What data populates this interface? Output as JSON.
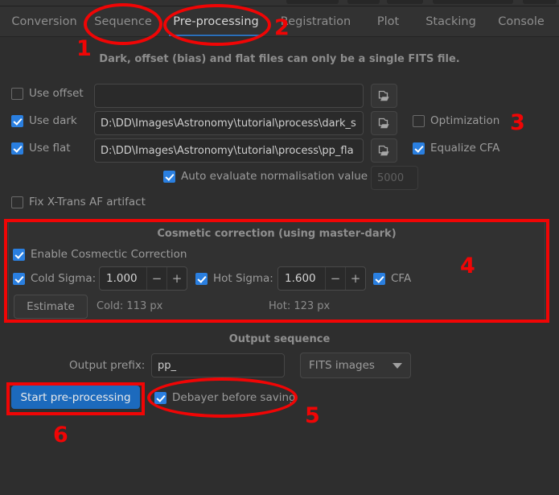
{
  "window": {
    "toolbar_buttons": [
      "",
      "",
      "",
      "",
      ""
    ]
  },
  "tabs": [
    {
      "label": "Conversion",
      "active": false
    },
    {
      "label": "Sequence",
      "active": false
    },
    {
      "label": "Pre-processing",
      "active": true
    },
    {
      "label": "Registration",
      "active": false
    },
    {
      "label": "Plot",
      "active": false
    },
    {
      "label": "Stacking",
      "active": false
    },
    {
      "label": "Console",
      "active": false
    }
  ],
  "preprocessing": {
    "note": "Dark, offset (bias) and flat files can only be a single FITS file.",
    "offset": {
      "checkbox_label": "Use offset",
      "checked": false,
      "path": "",
      "browse_icon": "open-file-icon"
    },
    "dark": {
      "checkbox_label": "Use dark",
      "checked": true,
      "path": "D:\\DD\\Images\\Astronomy\\tutorial\\process\\dark_s",
      "browse_icon": "open-file-icon",
      "optimization_label": "Optimization",
      "optimization_checked": false
    },
    "flat": {
      "checkbox_label": "Use flat",
      "checked": true,
      "path": "D:\\DD\\Images\\Astronomy\\tutorial\\process\\pp_fla",
      "browse_icon": "open-file-icon",
      "equalize_cfa_label": "Equalize CFA",
      "equalize_cfa_checked": true
    },
    "auto_normalisation": {
      "label": "Auto evaluate normalisation value",
      "checked": true,
      "value": "5000"
    },
    "xtrans": {
      "label": "Fix X-Trans AF artifact",
      "checked": false
    },
    "cosmetic": {
      "title": "Cosmetic correction (using master-dark)",
      "enable_label": "Enable Cosmectic Correction",
      "enable_checked": true,
      "cold_sigma": {
        "label": "Cold Sigma:",
        "checked": true,
        "value": "1.000",
        "minus": "−",
        "plus": "+"
      },
      "hot_sigma": {
        "label": "Hot Sigma:",
        "checked": true,
        "value": "1.600",
        "minus": "−",
        "plus": "+"
      },
      "cfa": {
        "label": "CFA",
        "checked": true
      },
      "estimate_button": "Estimate",
      "cold_stat": "Cold: 113 px",
      "hot_stat": "Hot: 123 px"
    },
    "output": {
      "title": "Output sequence",
      "prefix_label": "Output prefix:",
      "prefix_value": "pp_",
      "format_selected": "FITS images",
      "format_caret": "chevron-down-icon"
    },
    "actions": {
      "start_button": "Start pre-processing",
      "debayer_label": "Debayer before saving",
      "debayer_checked": true
    }
  },
  "annotations": {
    "color": "#f00505",
    "markers": [
      {
        "id": "1",
        "target": "Sequence tab"
      },
      {
        "id": "2",
        "target": "Pre-processing tab"
      },
      {
        "id": "3",
        "target": "Optimization checkbox"
      },
      {
        "id": "4",
        "target": "Cosmetic correction group"
      },
      {
        "id": "5",
        "target": "Debayer before saving"
      },
      {
        "id": "6",
        "target": "Start pre-processing button"
      }
    ]
  }
}
